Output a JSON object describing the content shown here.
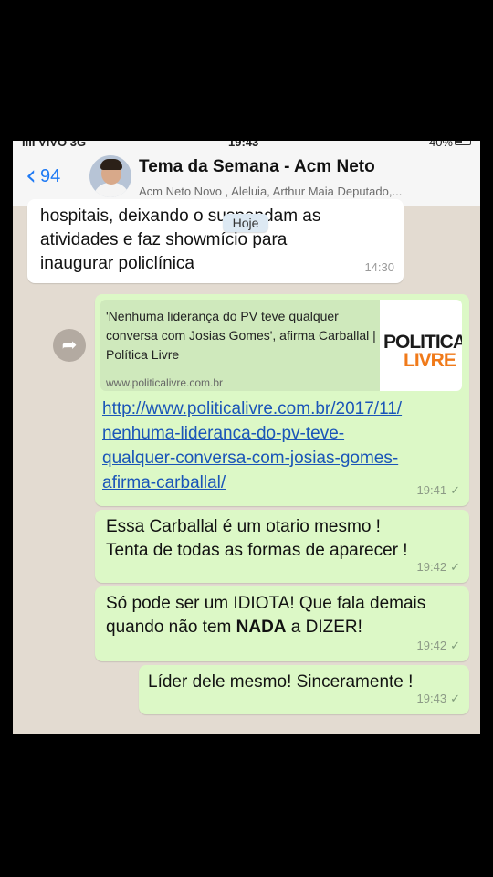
{
  "status_bar": {
    "carrier": "IIII VIVO  3G",
    "time": "19:43",
    "battery": "40%"
  },
  "header": {
    "back_count": "94",
    "title": "Tema da Semana - Acm Neto",
    "subtitle": "Acm Neto Novo , Aleluia, Arthur Maia Deputado,..."
  },
  "date_pill": "Hoje",
  "messages": [
    {
      "lines": [
        "hospitais, deixando o suspendam as",
        "atividades e faz showmício para",
        "inaugurar policlínica"
      ],
      "time": "14:30"
    },
    {
      "preview_title": "'Nenhuma liderança do PV teve qualquer conversa com Josias Gomes', afirma Carballal | Política Livre",
      "preview_url": "www.politicalivre.com.br",
      "logo_top": "POLITICA",
      "logo_bottom": "LIVRE",
      "link_lines": [
        "http://www.politicalivre.com.br/2017/11/",
        "nenhuma-lideranca-do-pv-teve-",
        "qualquer-conversa-com-josias-gomes-",
        "afirma-carballal/"
      ],
      "time": "19:41"
    },
    {
      "lines": [
        "Essa Carballal é um otario mesmo !",
        "Tenta de todas as formas de aparecer !"
      ],
      "time": "19:42"
    },
    {
      "line1": "Só pode ser um IDIOTA! Que fala demais",
      "line2_pre": "quando não tem ",
      "line2_bold": "NADA",
      "line2_post": "  a DIZER!",
      "time": "19:42"
    },
    {
      "lines": [
        "Líder dele mesmo! Sinceramente !"
      ],
      "time": "19:43"
    }
  ],
  "colors": {
    "outgoing": "#dcf8c6",
    "incoming": "#ffffff",
    "link": "#1a55b8",
    "accent": "#1f7af4"
  },
  "icons": {
    "back": "chevron-left-icon",
    "forward": "share-forward-icon",
    "tick": "check-icon"
  }
}
